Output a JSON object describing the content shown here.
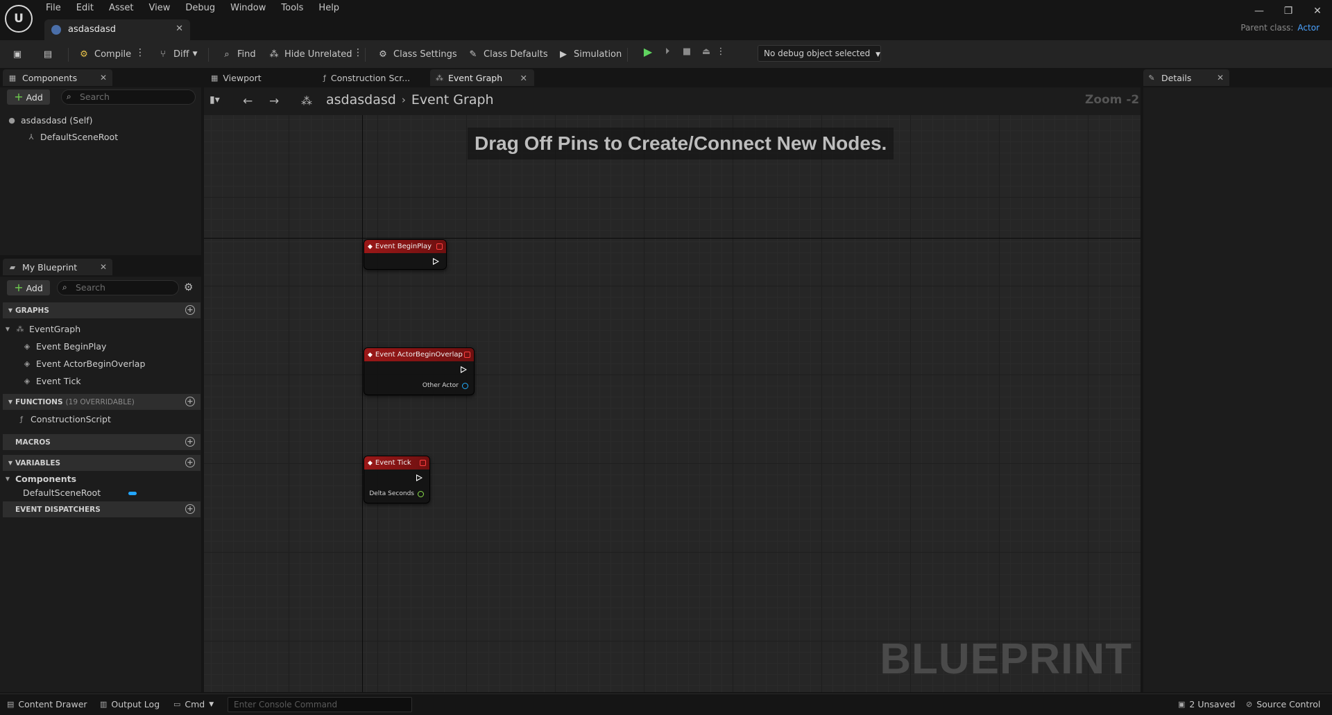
{
  "menu": [
    "File",
    "Edit",
    "Asset",
    "View",
    "Debug",
    "Window",
    "Tools",
    "Help"
  ],
  "doc_tab": "asdasdasd",
  "parent_class": {
    "label": "Parent class:",
    "value": "Actor"
  },
  "toolbar": {
    "compile": "Compile",
    "diff": "Diff",
    "find": "Find",
    "hide_unrelated": "Hide Unrelated",
    "class_settings": "Class Settings",
    "class_defaults": "Class Defaults",
    "simulation": "Simulation",
    "debug_object": "No debug object selected"
  },
  "components_panel": {
    "title": "Components",
    "add": "Add",
    "search_placeholder": "Search",
    "items": [
      "asdasdasd (Self)",
      "DefaultSceneRoot"
    ]
  },
  "my_blueprint": {
    "title": "My Blueprint",
    "add": "Add",
    "search_placeholder": "Search",
    "graphs_label": "GRAPHS",
    "event_graph": "EventGraph",
    "events": [
      "Event BeginPlay",
      "Event ActorBeginOverlap",
      "Event Tick"
    ],
    "functions_label": "FUNCTIONS",
    "functions_sub": "(19 OVERRIDABLE)",
    "construction_script": "ConstructionScript",
    "macros_label": "MACROS",
    "variables_label": "VARIABLES",
    "components_category": "Components",
    "variable_item": "DefaultSceneRoot",
    "dispatchers_label": "EVENT DISPATCHERS"
  },
  "graph": {
    "tabs": [
      "Viewport",
      "Construction Scr...",
      "Event Graph"
    ],
    "breadcrumb_root": "asdasdasd",
    "breadcrumb_leaf": "Event Graph",
    "zoom": "Zoom -2",
    "hint": "Drag Off Pins to Create/Connect New Nodes.",
    "watermark": "BLUEPRINT",
    "nodes": {
      "begin_play": "Event BeginPlay",
      "overlap": "Event ActorBeginOverlap",
      "overlap_pin": "Other Actor",
      "tick": "Event Tick",
      "tick_pin": "Delta Seconds"
    }
  },
  "details": {
    "title": "Details"
  },
  "status": {
    "content_drawer": "Content Drawer",
    "output_log": "Output Log",
    "cmd": "Cmd",
    "console_placeholder": "Enter Console Command",
    "unsaved": "2 Unsaved",
    "source_control": "Source Control"
  },
  "colors": {
    "accent": "#4ba3ff",
    "event_header": "#9a1818",
    "play": "#5fd35f"
  }
}
